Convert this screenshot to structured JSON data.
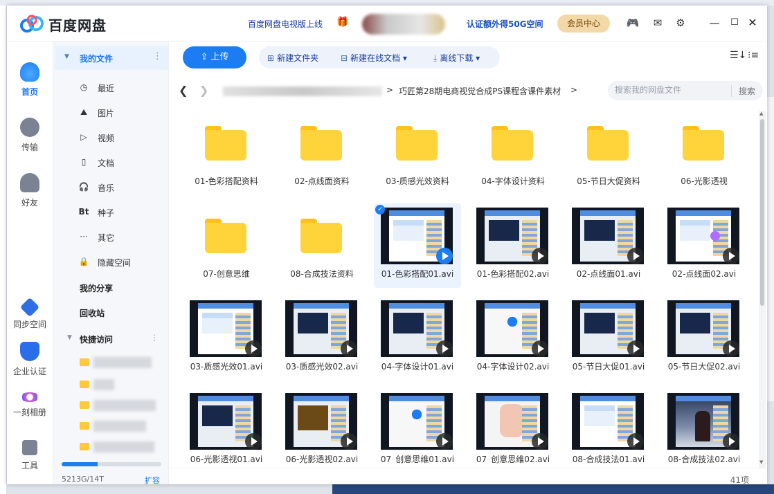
{
  "titlebar": {
    "brand": "百度网盘",
    "tv_link": "百度网盘电视版上线",
    "verify_link": "认证额外得50G空间",
    "vip_button": "会员中心",
    "min_glyph": "—",
    "max_glyph": "☐",
    "close_glyph": "✕"
  },
  "leftnav": {
    "items": [
      {
        "label": "首页",
        "icon": "home-cloud-icon"
      },
      {
        "label": "传输",
        "icon": "transfer-icon"
      },
      {
        "label": "好友",
        "icon": "friends-icon"
      },
      {
        "label": "同步空间",
        "icon": "sync-icon"
      },
      {
        "label": "企业认证",
        "icon": "enterprise-icon"
      },
      {
        "label": "一刻相册",
        "icon": "album-icon"
      },
      {
        "label": "工具",
        "icon": "tools-icon"
      }
    ]
  },
  "folderpanel": {
    "header": "我的文件",
    "items": [
      {
        "label": "最近",
        "glyph": "◷"
      },
      {
        "label": "图片",
        "glyph": "⛰"
      },
      {
        "label": "视频",
        "glyph": "▷"
      },
      {
        "label": "文档",
        "glyph": "▯"
      },
      {
        "label": "音乐",
        "glyph": "🎧"
      },
      {
        "label": "种子",
        "glyph": "Bt"
      },
      {
        "label": "其它",
        "glyph": "···"
      },
      {
        "label": "隐藏空间",
        "glyph": "🔒"
      }
    ],
    "my_share": "我的分享",
    "recycle": "回收站",
    "quick_access": "快捷访问",
    "storage_text": "5213G/14T",
    "storage_fraction": 0.36,
    "expand": "扩容"
  },
  "toolbar": {
    "upload": "上传",
    "new_folder": "新建文件夹",
    "new_doc": "新建在线文档",
    "offline_download": "离线下载"
  },
  "path": {
    "current": "巧匠第28期电商视觉合成PS课程含课件素材",
    "separator": ">"
  },
  "search": {
    "placeholder": "搜索我的网盘文件",
    "button": "搜索"
  },
  "files": [
    {
      "name": "01-色彩搭配资料",
      "kind": "folder"
    },
    {
      "name": "02-点线面资料",
      "kind": "folder"
    },
    {
      "name": "03-质感光效资料",
      "kind": "folder"
    },
    {
      "name": "04-字体设计资料",
      "kind": "folder"
    },
    {
      "name": "05-节日大促资料",
      "kind": "folder"
    },
    {
      "name": "06-光影透视",
      "kind": "folder"
    },
    {
      "name": "07-创意思维",
      "kind": "folder"
    },
    {
      "name": "08-合成技法资料",
      "kind": "folder"
    },
    {
      "name": "01-色彩搭配01.avi",
      "kind": "video",
      "style": "white",
      "selected": true
    },
    {
      "name": "01-色彩搭配02.avi",
      "kind": "video",
      "style": "dark"
    },
    {
      "name": "02-点线面01.avi",
      "kind": "video",
      "style": "dark"
    },
    {
      "name": "02-点线面02.avi",
      "kind": "video",
      "style": "white"
    },
    {
      "name": "03-质感光效01.avi",
      "kind": "video",
      "style": "white"
    },
    {
      "name": "03-质感光效02.avi",
      "kind": "video",
      "style": "dark"
    },
    {
      "name": "04-字体设计01.avi",
      "kind": "video",
      "style": "dark"
    },
    {
      "name": "04-字体设计02.avi",
      "kind": "video",
      "style": "logo"
    },
    {
      "name": "05-节日大促01.avi",
      "kind": "video",
      "style": "dark"
    },
    {
      "name": "05-节日大促02.avi",
      "kind": "video",
      "style": "dark"
    },
    {
      "name": "06-光影透视01.avi",
      "kind": "video",
      "style": "dark"
    },
    {
      "name": "06-光影透视02.avi",
      "kind": "video",
      "style": "food"
    },
    {
      "name": "07_创意思维01.avi",
      "kind": "video",
      "style": "logo"
    },
    {
      "name": "07_创意思维02.avi",
      "kind": "video",
      "style": "hand"
    },
    {
      "name": "08-合成技法01.avi",
      "kind": "video",
      "style": "white"
    },
    {
      "name": "08-合成技法02.avi",
      "kind": "video",
      "style": "photo"
    }
  ],
  "status": {
    "item_count": "41项"
  },
  "colors": {
    "accent": "#1c7df2",
    "folder": "#ffd43b",
    "vip": "#f3d9a8"
  }
}
